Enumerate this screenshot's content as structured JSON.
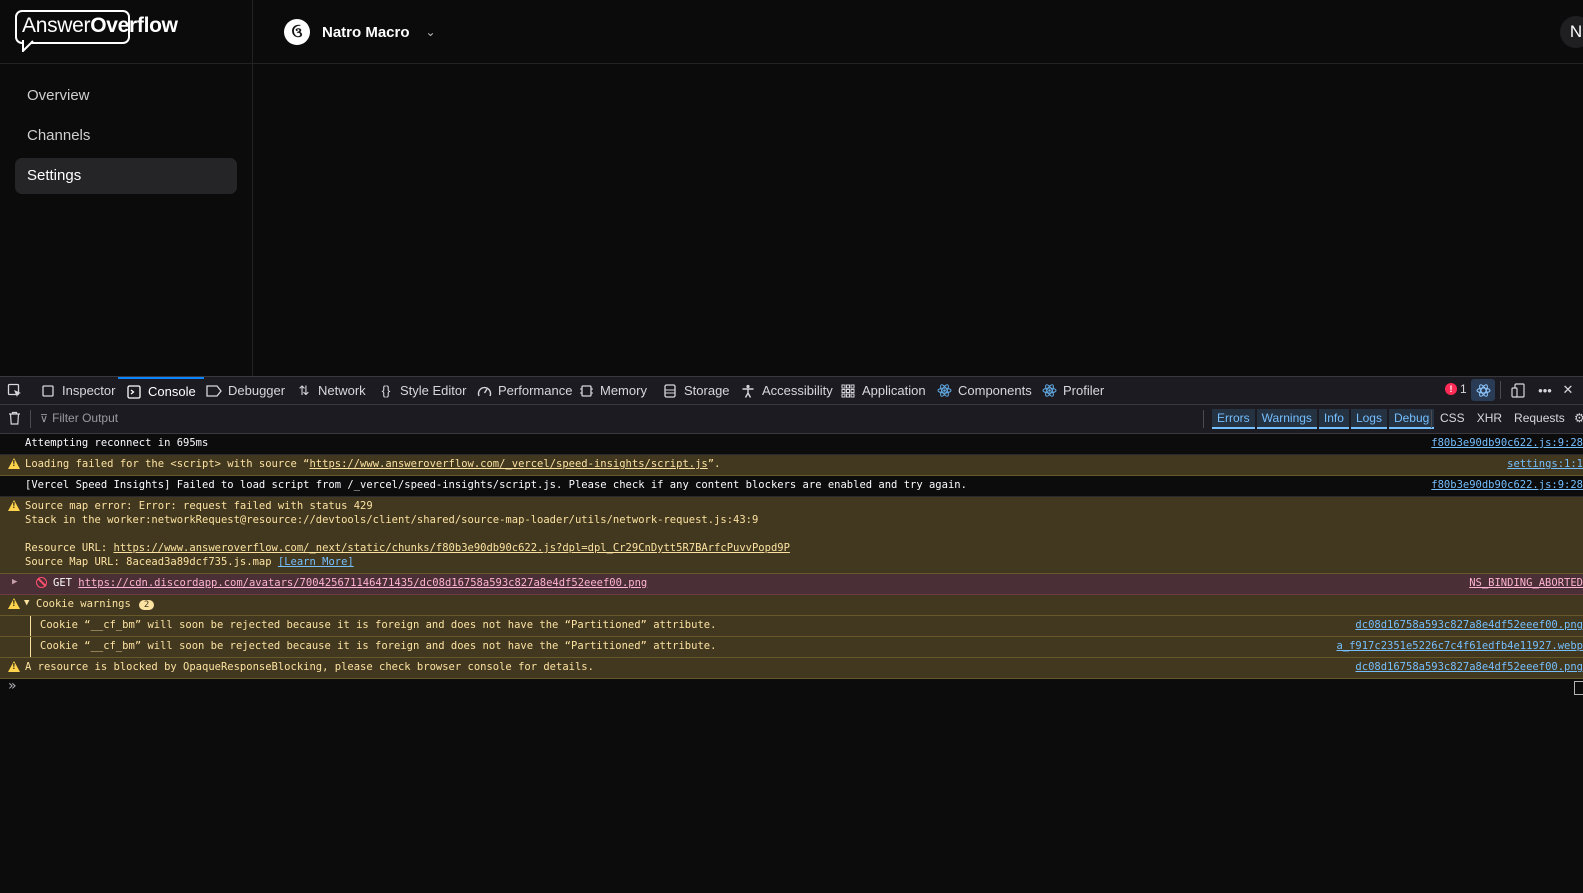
{
  "app": {
    "logo": {
      "part1": "Answer",
      "part2": "Overflow"
    },
    "server": {
      "name": "Natro Macro",
      "avatar_glyph": "ઉ"
    },
    "user_avatar": "N",
    "nav": [
      {
        "label": "Overview",
        "active": false
      },
      {
        "label": "Channels",
        "active": false
      },
      {
        "label": "Settings",
        "active": true
      }
    ]
  },
  "devtools": {
    "tabs": [
      {
        "label": "Inspector",
        "icon": "inspector-icon"
      },
      {
        "label": "Console",
        "icon": "console-icon"
      },
      {
        "label": "Debugger",
        "icon": "debugger-icon"
      },
      {
        "label": "Network",
        "icon": "network-icon"
      },
      {
        "label": "Style Editor",
        "icon": "braces-icon"
      },
      {
        "label": "Performance",
        "icon": "gauge-icon"
      },
      {
        "label": "Memory",
        "icon": "memory-icon"
      },
      {
        "label": "Storage",
        "icon": "storage-icon"
      },
      {
        "label": "Accessibility",
        "icon": "accessibility-icon"
      },
      {
        "label": "Application",
        "icon": "grid-icon"
      },
      {
        "label": "Components",
        "icon": "react-icon"
      },
      {
        "label": "Profiler",
        "icon": "react-icon"
      }
    ],
    "error_count": "1",
    "filter_placeholder": "Filter Output",
    "level_filters": [
      "Errors",
      "Warnings",
      "Info",
      "Logs",
      "Debug"
    ],
    "type_filters": [
      "CSS",
      "XHR",
      "Requests"
    ],
    "messages": {
      "m1": {
        "text": "Attempting reconnect in 695ms",
        "source": "f80b3e90db90c622.js:9:28"
      },
      "m2": {
        "pre": "Loading failed for the <script> with source “",
        "link": "https://www.answeroverflow.com/_vercel/speed-insights/script.js",
        "post": "”.",
        "source": "settings:1:1"
      },
      "m3": {
        "text": "[Vercel Speed Insights] Failed to load script from /_vercel/speed-insights/script.js. Please check if any content blockers are enabled and try again.",
        "source": "f80b3e90db90c622.js:9:28"
      },
      "m4": {
        "line1": "Source map error: Error: request failed with status 429",
        "line2": "Stack in the worker:networkRequest@resource://devtools/client/shared/source-map-loader/utils/network-request.js:43:9",
        "line3_label": "Resource URL: ",
        "line3_link": "https://www.answeroverflow.com/_next/static/chunks/f80b3e90db90c622.js?dpl=dpl_Cr29CnDytt5R7BArfcPuvvPopd9P",
        "line4_label": "Source Map URL: 8acead3a89dcf735.js.map ",
        "line4_link": "[Learn More]"
      },
      "m5": {
        "method": "GET",
        "link": "https://cdn.discordapp.com/avatars/700425671146471435/dc08d16758a593c827a8e4df52eeef00.png",
        "source": "NS_BINDING_ABORTED"
      },
      "m6": {
        "label": "Cookie warnings",
        "count": "2"
      },
      "m7": {
        "text": "Cookie “__cf_bm” will soon be rejected because it is foreign and does not have the “Partitioned” attribute.",
        "source": "dc08d16758a593c827a8e4df52eeef00.png"
      },
      "m8": {
        "text": "Cookie “__cf_bm” will soon be rejected because it is foreign and does not have the “Partitioned” attribute.",
        "source": "a_f917c2351e5226c7c4f61edfb4e11927.webp"
      },
      "m9": {
        "text": "A resource is blocked by OpaqueResponseBlocking, please check browser console for details.",
        "source": "dc08d16758a593c827a8e4df52eeef00.png"
      }
    }
  }
}
